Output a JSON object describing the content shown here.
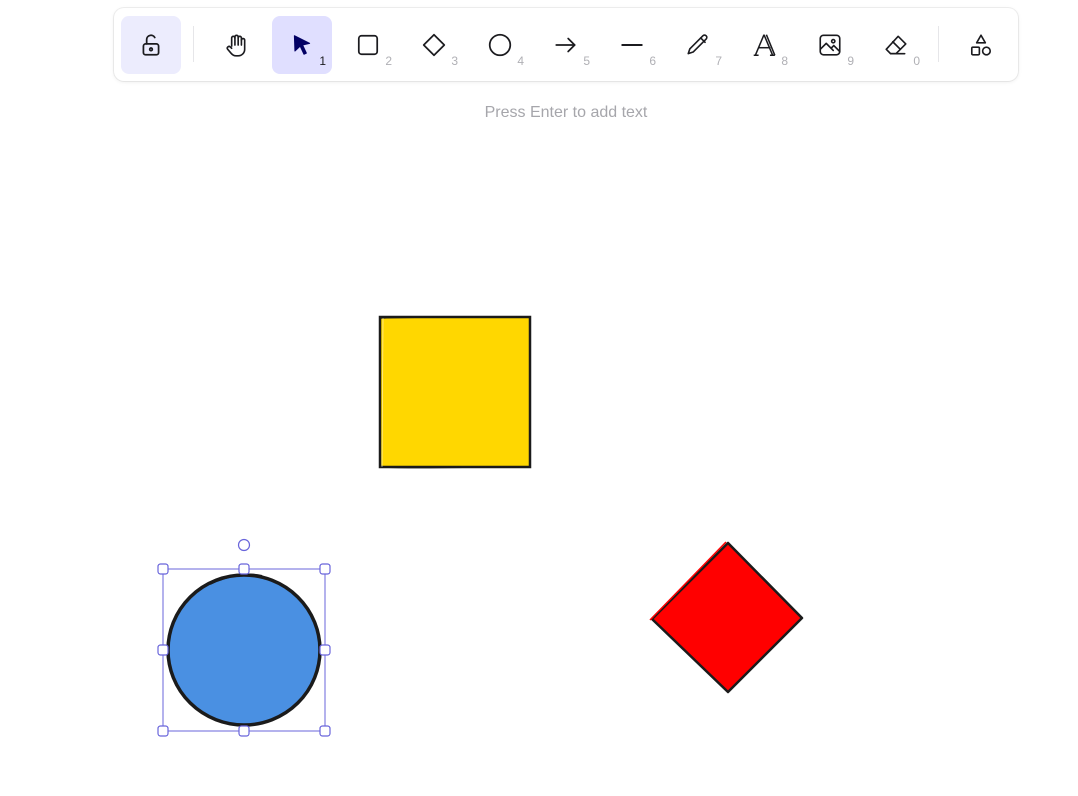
{
  "toolbar": {
    "tools": [
      {
        "name": "lock",
        "icon": "unlock-icon",
        "key": ""
      },
      {
        "name": "hand",
        "icon": "hand-icon",
        "key": ""
      },
      {
        "name": "selection",
        "icon": "pointer-icon",
        "key": "1"
      },
      {
        "name": "rectangle",
        "icon": "rectangle-icon",
        "key": "2"
      },
      {
        "name": "diamond",
        "icon": "diamond-icon",
        "key": "3"
      },
      {
        "name": "ellipse",
        "icon": "circle-icon",
        "key": "4"
      },
      {
        "name": "arrow",
        "icon": "arrow-icon",
        "key": "5"
      },
      {
        "name": "line",
        "icon": "line-icon",
        "key": "6"
      },
      {
        "name": "draw",
        "icon": "pencil-icon",
        "key": "7"
      },
      {
        "name": "text",
        "icon": "text-icon",
        "key": "8"
      },
      {
        "name": "image",
        "icon": "image-icon",
        "key": "9"
      },
      {
        "name": "eraser",
        "icon": "eraser-icon",
        "key": "0"
      },
      {
        "name": "library",
        "icon": "shapes-icon",
        "key": ""
      }
    ],
    "active_tool": "selection"
  },
  "hint": "Press Enter to add text",
  "canvas": {
    "elements": [
      {
        "type": "rectangle",
        "fill": "#ffd700",
        "stroke": "#1b1b1b"
      },
      {
        "type": "ellipse",
        "fill": "#4a90e2",
        "stroke": "#1b1b1b",
        "selected": true
      },
      {
        "type": "diamond",
        "fill": "#ff0000",
        "stroke": "#1b1b1b"
      }
    ],
    "selection_color": "#6965db"
  }
}
